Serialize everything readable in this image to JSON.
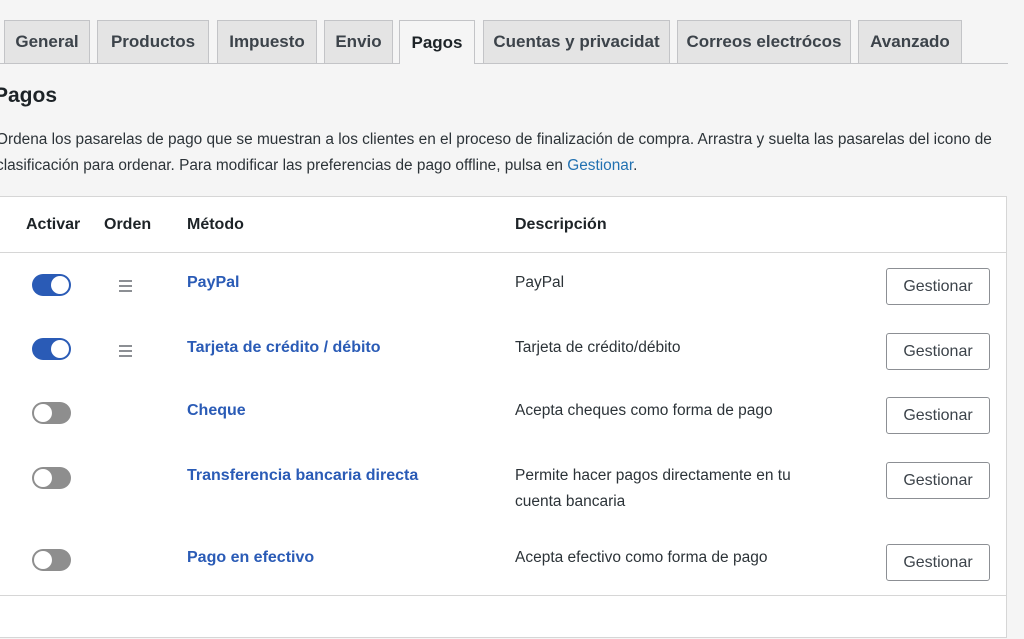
{
  "tabs": [
    {
      "label": "General"
    },
    {
      "label": "Productos"
    },
    {
      "label": "Impuesto"
    },
    {
      "label": "Envio"
    },
    {
      "label": "Pagos"
    },
    {
      "label": "Cuentas y privacidat"
    },
    {
      "label": "Correos electrócos"
    },
    {
      "label": "Avanzado"
    }
  ],
  "active_tab": "Pagos",
  "page": {
    "title": "Pagos",
    "description": "Ordena los pasarelas de pago que se muestran a los clientes en el proceso de finalización de compra. Arrastra y suelta las pasarelas del icono de clasificación para ordenar. Para modificar las preferencias de pago offline, pulsa en ",
    "description_link": "Gestionar",
    "description_end": "."
  },
  "table": {
    "headers": {
      "enable": "Activar",
      "order": "Orden",
      "method": "Método",
      "description": "Descripción"
    },
    "rows": [
      {
        "enabled": true,
        "draggable": true,
        "method": "PayPal",
        "description": "PayPal",
        "action": "Gestionar"
      },
      {
        "enabled": true,
        "draggable": true,
        "method": "Tarjeta de crédito / débito",
        "description": "Tarjeta de crédito/débito",
        "action": "Gestionar"
      },
      {
        "enabled": false,
        "draggable": false,
        "method": "Cheque",
        "description": "Acepta cheques como forma de pago",
        "action": "Gestionar"
      },
      {
        "enabled": false,
        "draggable": false,
        "method": "Transferencia bancaria directa",
        "description": "Permite hacer pagos directamente en tu cuenta bancaria",
        "action": "Gestionar"
      },
      {
        "enabled": false,
        "draggable": false,
        "method": "Pago en efectivo",
        "description": "Acepta efectivo como forma de pago",
        "action": "Gestionar"
      }
    ]
  },
  "colors": {
    "accent": "#2a5bb6",
    "toggle_off": "#8e8e8e",
    "link": "#2271b1"
  },
  "icons": {
    "order": "drag-handle-icon"
  }
}
